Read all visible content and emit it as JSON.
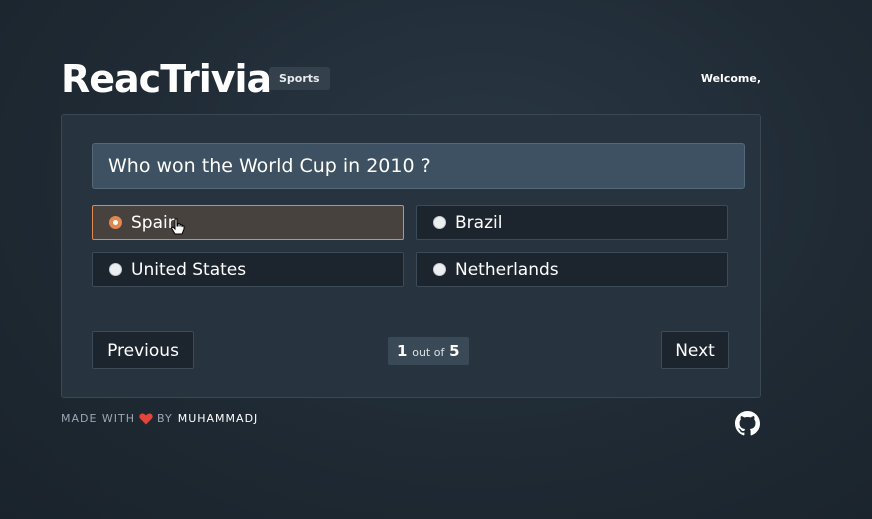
{
  "header": {
    "logo_text": "ReacTrivia",
    "category": "Sports",
    "welcome": "Welcome,"
  },
  "quiz": {
    "question": "Who won the World Cup in 2010 ?",
    "options": [
      {
        "label": "Spain",
        "selected": true
      },
      {
        "label": "Brazil",
        "selected": false
      },
      {
        "label": "United States",
        "selected": false
      },
      {
        "label": "Netherlands",
        "selected": false
      }
    ],
    "previous_label": "Previous",
    "next_label": "Next",
    "progress": {
      "current": "1",
      "separator": "out of",
      "total": "5"
    }
  },
  "footer": {
    "made_with": "MADE WITH",
    "by": "BY",
    "author": "MUHAMMADJ",
    "heart_icon": "heart-icon",
    "github_icon": "github-icon"
  },
  "colors": {
    "accent": "#e2874f",
    "heart": "#e2453c",
    "card": "#27333e",
    "question_bg": "#3e5162"
  }
}
